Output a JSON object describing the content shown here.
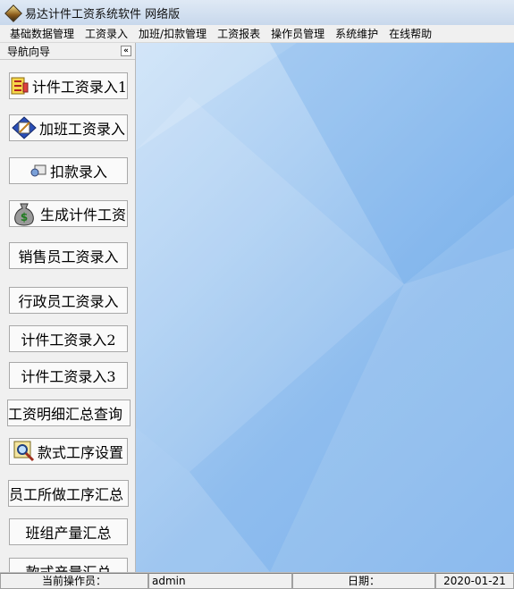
{
  "window": {
    "title": "易达计件工资系统软件  网络版"
  },
  "menu": {
    "items": [
      "基础数据管理",
      "工资录入",
      "加班/扣款管理",
      "工资报表",
      "操作员管理",
      "系统维护",
      "在线帮助"
    ]
  },
  "sidebar": {
    "title": "导航向导",
    "collapse_label": "«",
    "buttons": [
      {
        "label": "计件工资录入1",
        "icon": "data-entry-icon"
      },
      {
        "label": "加班工资录入",
        "icon": "overtime-edit-icon"
      },
      {
        "label": "扣款录入",
        "icon": "deduction-icon"
      },
      {
        "label": "生成计件工资",
        "icon": "money-bag-icon"
      },
      {
        "label": "销售员工资录入",
        "icon": ""
      },
      {
        "label": "行政员工资录入",
        "icon": ""
      },
      {
        "label": "计件工资录入2",
        "icon": ""
      },
      {
        "label": "计件工资录入3",
        "icon": ""
      },
      {
        "label": "工资明细汇总查询",
        "icon": ""
      },
      {
        "label": "款式工序设置",
        "icon": "search-settings-icon"
      },
      {
        "label": "员工所做工序汇总",
        "icon": ""
      },
      {
        "label": "班组产量汇总",
        "icon": ""
      },
      {
        "label": "款式产量汇总",
        "icon": ""
      }
    ]
  },
  "status": {
    "operator_label": "当前操作员：",
    "operator_value": "admin",
    "date_label": "日期：",
    "date_value": "2020-01-21"
  }
}
